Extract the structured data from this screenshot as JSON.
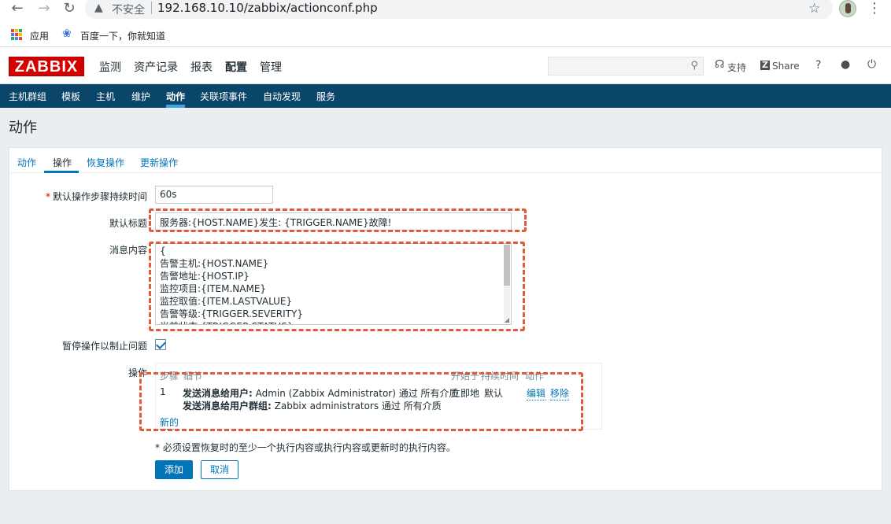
{
  "browser": {
    "insecure_label": "不安全",
    "url": "192.168.10.10/zabbix/actionconf.php",
    "bookmarks": [
      {
        "label": "应用"
      },
      {
        "label": "百度一下，你就知道"
      }
    ]
  },
  "header": {
    "logo": "ZABBIX",
    "menu": [
      {
        "label": "监测"
      },
      {
        "label": "资产记录"
      },
      {
        "label": "报表"
      },
      {
        "label": "配置"
      },
      {
        "label": "管理"
      }
    ],
    "support_label": "支持",
    "share_label": "Share",
    "help_label": "?"
  },
  "subnav": {
    "items": [
      {
        "label": "主机群组"
      },
      {
        "label": "模板"
      },
      {
        "label": "主机"
      },
      {
        "label": "维护"
      },
      {
        "label": "动作"
      },
      {
        "label": "关联项事件"
      },
      {
        "label": "自动发现"
      },
      {
        "label": "服务"
      }
    ]
  },
  "page": {
    "title": "动作"
  },
  "tabs": [
    {
      "label": "动作"
    },
    {
      "label": "操作"
    },
    {
      "label": "恢复操作"
    },
    {
      "label": "更新操作"
    }
  ],
  "form": {
    "step_duration_label": "默认操作步骤持续时间",
    "step_duration_value": "60s",
    "subject_label": "默认标题",
    "subject_value": "服务器:{HOST.NAME}发生: {TRIGGER.NAME}故障!",
    "message_label": "消息内容",
    "message_lines": [
      "{",
      "告警主机:{HOST.NAME}",
      "告警地址:{HOST.IP}",
      "监控项目:{ITEM.NAME}",
      "监控取值:{ITEM.LASTVALUE}",
      "告警等级:{TRIGGER.SEVERITY}",
      "当前状态:{TRIGGER.STATUS}"
    ],
    "pause_label": "暂停操作以制止问题",
    "pause_checked": true,
    "operations_label": "操作",
    "operations_headers": {
      "steps": "步骤",
      "details": "细节",
      "start_in": "开始于",
      "duration": "持续时间",
      "action": "动作"
    },
    "operations_rows": [
      {
        "step": "1",
        "detail1_bold": "发送消息给用户:",
        "detail1_text": " Admin (Zabbix Administrator) 通过 所有介质",
        "detail2_bold": "发送消息给用户群组:",
        "detail2_text": " Zabbix administrators 通过 所有介质",
        "start_in": "立即地",
        "duration": "默认",
        "edit_label": "编辑",
        "remove_label": "移除"
      }
    ],
    "new_label": "新的",
    "note": "* 必须设置恢复时的至少一个执行内容或执行内容或更新时的执行内容。",
    "add_button": "添加",
    "cancel_button": "取消"
  }
}
